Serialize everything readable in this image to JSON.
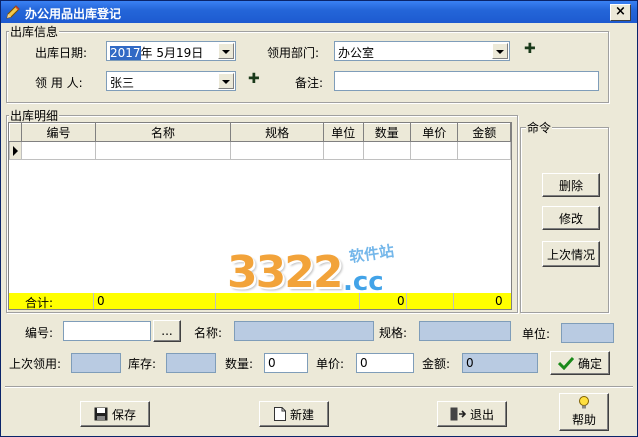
{
  "window": {
    "title": "办公用品出库登记",
    "close": "×"
  },
  "info_group": {
    "title": "出库信息",
    "date_label": "出库日期:",
    "date_year": "2017",
    "date_rest": "年  5月19日",
    "dept_label": "领用部门:",
    "dept_value": "办公室",
    "user_label": "领 用 人:",
    "user_value": "张三",
    "note_label": "备注:",
    "note_value": "",
    "plus": "✚"
  },
  "detail_group": {
    "title": "出库明细",
    "columns": [
      "编号",
      "名称",
      "规格",
      "单位",
      "数量",
      "单价",
      "金额"
    ],
    "sum_label": "合计:",
    "sum_qty_left": "0",
    "sum_qty": "0",
    "sum_amount": "0"
  },
  "command_group": {
    "title": "命令",
    "delete": "删除",
    "edit": "修改",
    "last": "上次情况"
  },
  "entry": {
    "code_label": "编号:",
    "browse": "...",
    "name_label": "名称:",
    "spec_label": "规格:",
    "unit_label": "单位:",
    "last_use_label": "上次领用:",
    "stock_label": "库存:",
    "qty_label": "数量:",
    "qty_value": "0",
    "price_label": "单价:",
    "price_value": "0",
    "amount_label": "金额:",
    "amount_value": "0",
    "confirm": "确定"
  },
  "footer": {
    "save": "保存",
    "new": "新建",
    "exit": "退出",
    "help": "帮助"
  },
  "watermark": {
    "number": "3322",
    "suffix": ".cc",
    "tag": "软件站"
  }
}
